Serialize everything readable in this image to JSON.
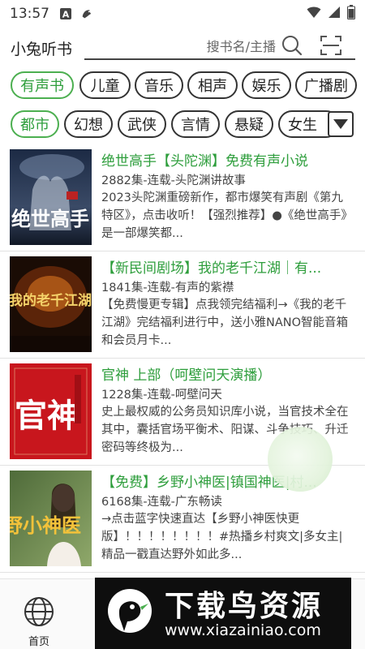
{
  "status_bar": {
    "time": "13:57"
  },
  "header": {
    "title": "小兔听书",
    "search_placeholder": "搜书名/主播"
  },
  "categories_row1": [
    {
      "label": "有声书",
      "active": true
    },
    {
      "label": "儿童",
      "active": false
    },
    {
      "label": "音乐",
      "active": false
    },
    {
      "label": "相声",
      "active": false
    },
    {
      "label": "娱乐",
      "active": false
    },
    {
      "label": "广播剧",
      "active": false
    }
  ],
  "categories_row2": [
    {
      "label": "都市",
      "active": true
    },
    {
      "label": "幻想",
      "active": false
    },
    {
      "label": "武侠",
      "active": false
    },
    {
      "label": "言情",
      "active": false
    },
    {
      "label": "悬疑",
      "active": false
    },
    {
      "label": "女生",
      "active": false
    }
  ],
  "books": [
    {
      "title": "绝世高手【头陀渊】免费有声小说",
      "meta": "2882集-连载-头陀渊讲故事",
      "desc": "2023头陀渊重磅新作，都市爆笑有声剧《第九特区》，点击收听！【强烈推荐】●《绝世高手》是一部爆笑都...",
      "cover_text": "绝世高手"
    },
    {
      "title": "【新民间剧场】我的老千江湖｜有...",
      "meta": "1841集-连载-有声的紫襟",
      "desc": "【免费慢更专辑】点我领完结福利→《我的老千江湖》完结福利进行中，送小雅NANO智能音箱和会员月卡...",
      "cover_text": "我的老千江湖"
    },
    {
      "title": "官神 上部（呵壁问天演播）",
      "meta": "1228集-连载-呵壁问天",
      "desc": "史上最权威的公务员知识库小说，当官技术全在其中，囊括官场平衡术、阳谋、斗争技巧、升迁密码等终极为...",
      "cover_text": "官神"
    },
    {
      "title": "【免费】乡野小神医|镇国神医|村...",
      "meta": "6168集-连载-广东畅读",
      "desc": "→点击蓝字快速直达【乡野小神医快更版】！！！！！！！！#热播乡村爽文|多女主|精品一戳直达野外如此多...",
      "cover_text": "乡野小神医"
    }
  ],
  "bottom_nav": {
    "home_label": "首页"
  },
  "watermark": {
    "main": "下载鸟资源",
    "url": "www.xiazainiao.com"
  },
  "colors": {
    "accent": "#2e9e3c",
    "chip_active_border": "#4caf50"
  }
}
